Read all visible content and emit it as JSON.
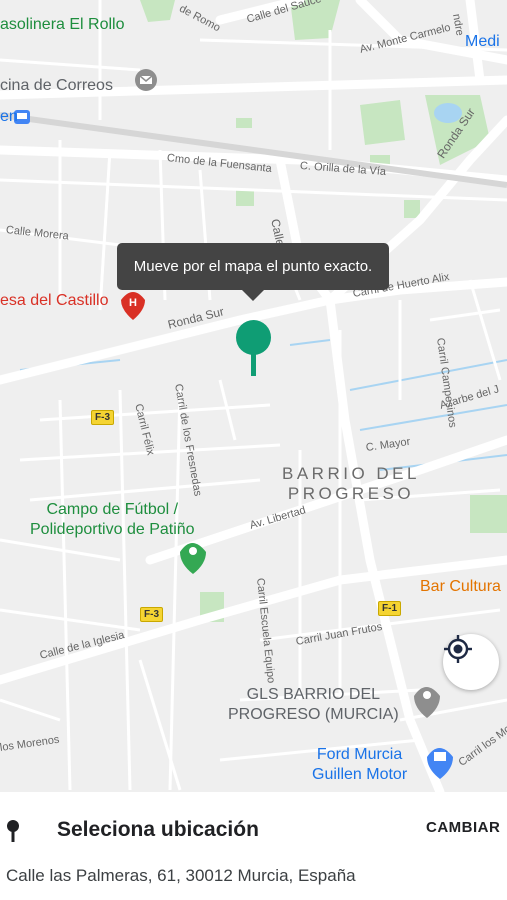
{
  "map": {
    "tooltip": "Mueve por el mapa el punto exacto.",
    "places": {
      "gasolinera": "asolinera El Rollo",
      "correos": "cina de Correos",
      "castillo": "esa del Castillo",
      "campo_line1": "Campo de Fútbol /",
      "campo_line2": "Polideportivo de Patiño",
      "barrio_line1": "BARRIO DEL",
      "barrio_line2": "PROGRESO",
      "gls_line1": "GLS BARRIO DEL",
      "gls_line2": "PROGRESO (MURCIA)",
      "ford_line1": "Ford Murcia",
      "ford_line2": "Guillen Motor",
      "bar": "Bar Cultura",
      "medi": "Medi",
      "renfe": "en"
    },
    "streets": {
      "romo": "de Romo",
      "sauce": "Calle del Sauce",
      "monte_carmelo": "Av. Monte Carmelo",
      "fuensanta": "Cmo de la Fuensanta",
      "orilla": "C. Orilla de la Vía",
      "pio": "Calle Pío XII",
      "morera": "Calle Morera",
      "ronda_sur_left": "Ronda Sur",
      "ronda_sur_right": "Ronda Sur",
      "huerto_alix": "Carril de Huerto Alix",
      "campesinos": "Carril Campesinos",
      "fresnedas": "Carril de los Fresnedas",
      "felix": "Carril Félix",
      "azarbe": "Azarbe del J",
      "mayor": "C. Mayor",
      "libertad": "Av. Libertad",
      "escuela": "Carril Escuela Equipo",
      "juan_frutos": "Carril Juan Frutos",
      "iglesia": "Calle de la Iglesia",
      "morenos": "los Morenos",
      "losmoz": "Carril los Moz",
      "ndre": "ndre"
    },
    "routes": {
      "r1": "F-3",
      "r2": "F-3",
      "r3": "F-1"
    }
  },
  "sheet": {
    "title": "Seleciona ubicación",
    "change_label": "CAMBIAR",
    "address": "Calle las Palmeras, 61, 30012 Murcia, España"
  },
  "colors": {
    "pin": "#0f9d74",
    "tooltip_bg": "#444444",
    "park": "#c7e6c1",
    "water": "#a8d4f2"
  },
  "icons": {
    "pin": "map-pin-icon",
    "locate": "my-location-icon",
    "sheet": "location-marker-icon",
    "hospital": "hospital-icon",
    "mail": "mail-icon",
    "field": "place-icon",
    "shop": "shopping-icon",
    "train": "train-icon"
  }
}
